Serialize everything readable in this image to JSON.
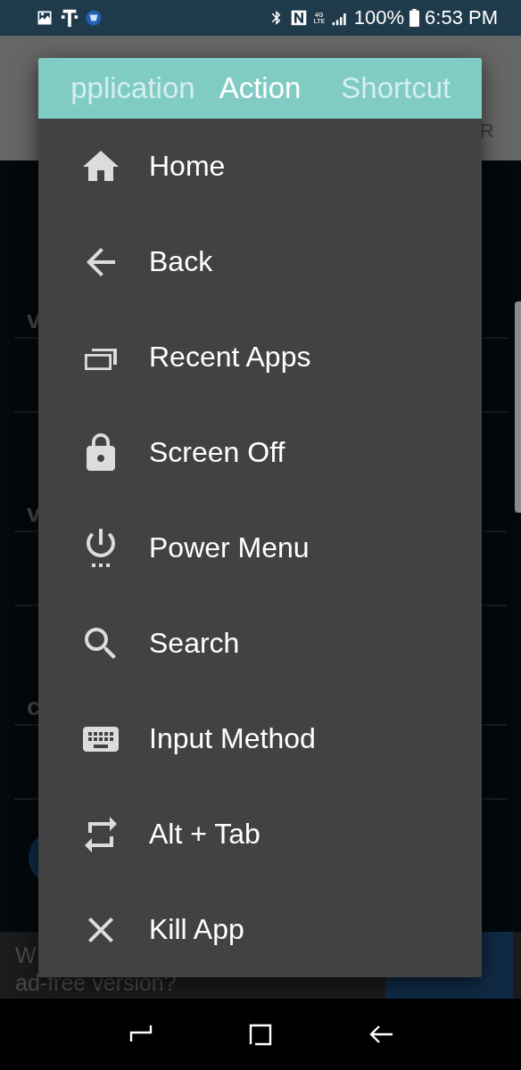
{
  "status_bar": {
    "network_type": "4G LTE",
    "battery": "100%",
    "time": "6:53 PM"
  },
  "app_bar": {
    "text": "R"
  },
  "background_rows": [
    {
      "label": "v"
    },
    {
      "label": "v"
    },
    {
      "label": "c"
    }
  ],
  "ad_banner": {
    "line_1": "W",
    "line_2": "ad-free version?"
  },
  "dialog": {
    "tabs": [
      {
        "label": "pplication",
        "selected": false
      },
      {
        "label": "Action",
        "selected": true
      },
      {
        "label": "Shortcut",
        "selected": false
      }
    ],
    "items": [
      {
        "label": "Home"
      },
      {
        "label": "Back"
      },
      {
        "label": "Recent Apps"
      },
      {
        "label": "Screen Off"
      },
      {
        "label": "Power Menu"
      },
      {
        "label": "Search"
      },
      {
        "label": "Input Method"
      },
      {
        "label": "Alt + Tab"
      },
      {
        "label": "Kill App"
      }
    ]
  }
}
